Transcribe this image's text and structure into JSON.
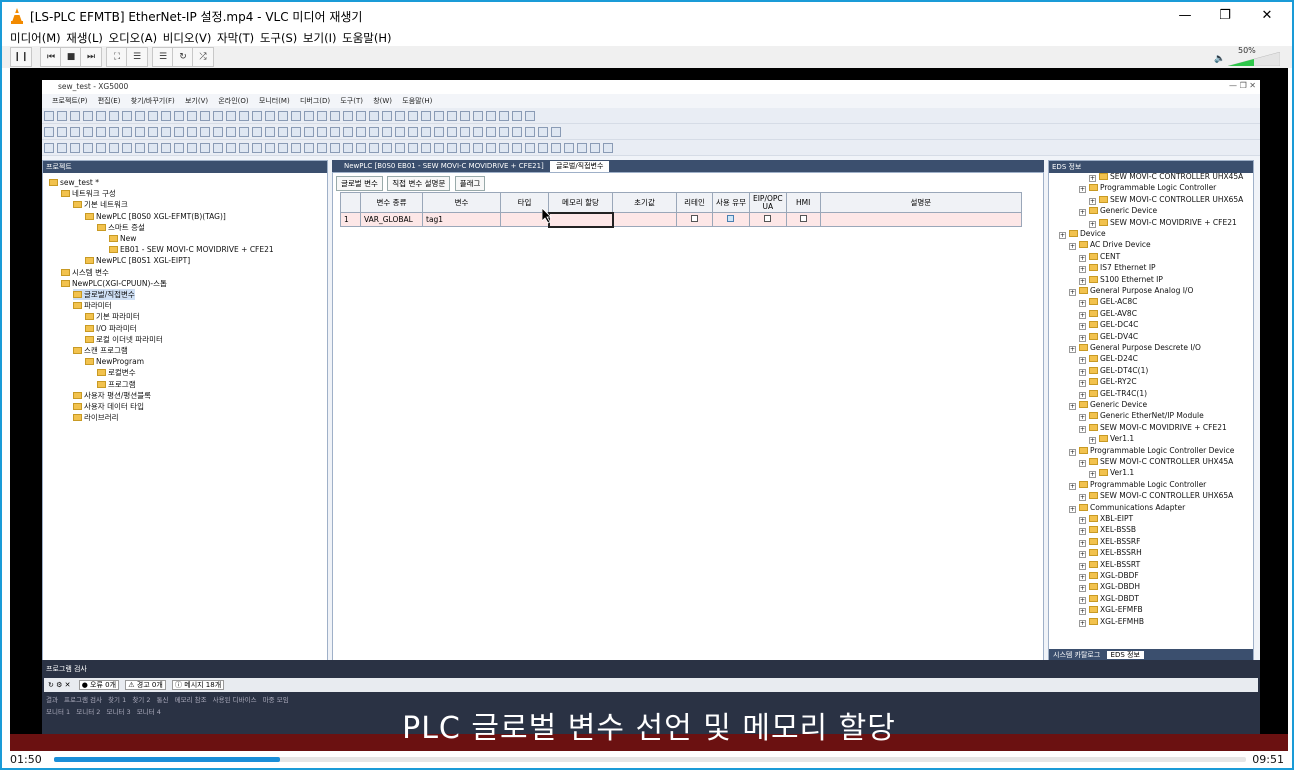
{
  "vlc": {
    "title": "[LS-PLC EFMTB] EtherNet-IP 설정.mp4 - VLC 미디어 재생기",
    "menu": [
      "미디어(M)",
      "재생(L)",
      "오디오(A)",
      "비디오(V)",
      "자막(T)",
      "도구(S)",
      "보기(I)",
      "도움말(H)"
    ],
    "volume_label": "50%",
    "volume_level": 0.5,
    "time_current": "01:50",
    "time_total": "09:51",
    "progress": 0.19
  },
  "xg": {
    "title": "sew_test - XG5000",
    "menu": [
      "프로젝트(P)",
      "편집(E)",
      "찾기/바꾸기(F)",
      "보기(V)",
      "온라인(O)",
      "모니터(M)",
      "디버그(D)",
      "도구(T)",
      "창(W)",
      "도움말(H)"
    ],
    "project_header": "프로젝트",
    "project_tree": [
      "sew_test *",
      "네트워크 구성",
      "기본 네트워크",
      "NewPLC [B0S0 XGL-EFMT(B)(TAG)]",
      "스마트 증설",
      "New",
      "EB01 - SEW MOVI-C MOVIDRIVE + CFE21",
      "NewPLC [B0S1 XGL-EIPT]",
      "시스템 변수",
      "NewPLC(XGI-CPUUN)-스톱",
      "글로벌/직접변수",
      "파라미터",
      "기본 파라미터",
      "I/O 파라미터",
      "로컬 이더넷 파라미터",
      "스캔 프로그램",
      "NewProgram",
      "로컬변수",
      "프로그램",
      "사용자 평션/평션블록",
      "사용자 데이터 타입",
      "라이브러리"
    ],
    "doc_tabs": [
      "NewPLC [B0S0 EB01 - SEW MOVI-C MOVIDRIVE + CFE21]",
      "글로벌/직접변수"
    ],
    "sub_tabs": [
      "글로벌 변수",
      "직접 변수 설명문",
      "플래그"
    ],
    "grid_headers": [
      "변수 종류",
      "변수",
      "타입",
      "메모리 할당",
      "초기값",
      "리테인",
      "사용 유무",
      "EIP/OPC UA",
      "HMI",
      "설명문"
    ],
    "grid_rows": [
      [
        "1",
        "VAR_GLOBAL",
        "tag1"
      ]
    ],
    "eds_header": "EDS 정보",
    "eds_tree": [
      "SEW MOVI-C CONTROLLER UHX45A",
      "Programmable Logic Controller",
      "SEW MOVI-C CONTROLLER UHX65A",
      "Generic Device",
      "SEW MOVI-C MOVIDRIVE + CFE21",
      "Device",
      "AC Drive Device",
      "CENT",
      "IS7 Ethernet IP",
      "S100 Ethernet IP",
      "General Purpose Analog I/O",
      "GEL-AC8C",
      "GEL-AV8C",
      "GEL-DC4C",
      "GEL-DV4C",
      "General Purpose Descrete I/O",
      "GEL-D24C",
      "GEL-DT4C(1)",
      "GEL-RY2C",
      "GEL-TR4C(1)",
      "Generic Device",
      "Generic EtherNet/IP Module",
      "SEW MOVI-C MOVIDRIVE + CFE21",
      "Ver1.1",
      "Programmable Logic Controller Device",
      "SEW MOVI-C CONTROLLER UHX45A",
      "Ver1.1",
      "Programmable Logic Controller",
      "SEW MOVI-C CONTROLLER UHX65A",
      "Communications Adapter",
      "XBL-EIPT",
      "XEL-BSSB",
      "XEL-BSSRF",
      "XEL-BSSRH",
      "XEL-BSSRT",
      "XGL-DBDF",
      "XGL-DBDH",
      "XGL-DBDT",
      "XGL-EFMFB",
      "XGL-EFMHB"
    ],
    "eds_tabs": [
      "시스템 카탈로그",
      "EDS 정보"
    ],
    "check_header": "프로그램 검사",
    "check_badges": [
      "오류 0개",
      "경고 0개",
      "메시지 18개"
    ],
    "bottom_tabs": [
      "결과",
      "프로그램 검사",
      "찾기 1",
      "찾기 2",
      "통신",
      "메모리 참조",
      "사용된 디바이스",
      "마중 모임"
    ],
    "monitor_tabs": [
      "모니터 1",
      "모니터 2",
      "모니터 3",
      "모니터 4"
    ]
  },
  "subtitle": "PLC 글로벌 변수 선언 및 메모리 할당"
}
